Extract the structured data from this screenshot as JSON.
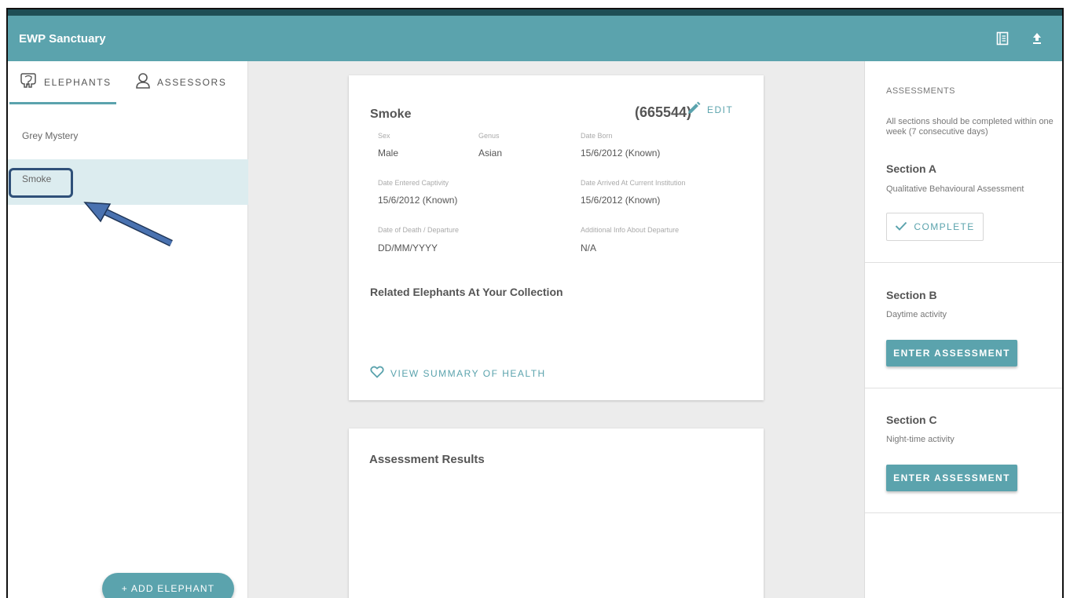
{
  "app": {
    "title": "EWP Sanctuary"
  },
  "appbar": {
    "icons": [
      "notebook-icon",
      "upload-icon"
    ]
  },
  "sidebar": {
    "tabs": [
      {
        "label": "ELEPHANTS",
        "icon": "elephant-icon",
        "active": true
      },
      {
        "label": "ASSESSORS",
        "icon": "person-icon",
        "active": false
      }
    ],
    "items": [
      {
        "label": "Grey Mystery",
        "selected": false
      },
      {
        "label": "Smoke",
        "selected": true
      }
    ],
    "add_button": "+ ADD ELEPHANT"
  },
  "elephant": {
    "name": "Smoke",
    "id": "(665544)",
    "edit_label": "EDIT",
    "fields": {
      "sex": {
        "label": "Sex",
        "value": "Male"
      },
      "genus": {
        "label": "Genus",
        "value": "Asian"
      },
      "date_born": {
        "label": "Date Born",
        "value": "15/6/2012 (Known)"
      },
      "date_entered": {
        "label": "Date Entered Captivity",
        "value": "15/6/2012 (Known)"
      },
      "date_arrived": {
        "label": "Date Arrived At Current Institution",
        "value": "15/6/2012 (Known)"
      },
      "date_death": {
        "label": "Date of Death / Departure",
        "value": "DD/MM/YYYY"
      },
      "additional": {
        "label": "Additional Info About Departure",
        "value": "N/A"
      }
    },
    "related_title": "Related Elephants At Your Collection",
    "health_label": "VIEW SUMMARY OF HEALTH"
  },
  "results": {
    "title": "Assessment Results"
  },
  "assessments": {
    "header": "ASSESSMENTS",
    "note": "All sections should be completed within one week (7 consecutive days)",
    "sections": [
      {
        "title": "Section A",
        "desc": "Qualitative Behavioural Assessment",
        "button": "COMPLETE",
        "status": "complete"
      },
      {
        "title": "Section B",
        "desc": "Daytime activity",
        "button": "ENTER ASSESSMENT",
        "status": "pending"
      },
      {
        "title": "Section C",
        "desc": "Night-time activity",
        "button": "ENTER ASSESSMENT",
        "status": "pending"
      }
    ]
  },
  "colors": {
    "primary": "#5ba3ad",
    "highlight_box": "#2f5079",
    "arrow": "#4a72b0"
  }
}
